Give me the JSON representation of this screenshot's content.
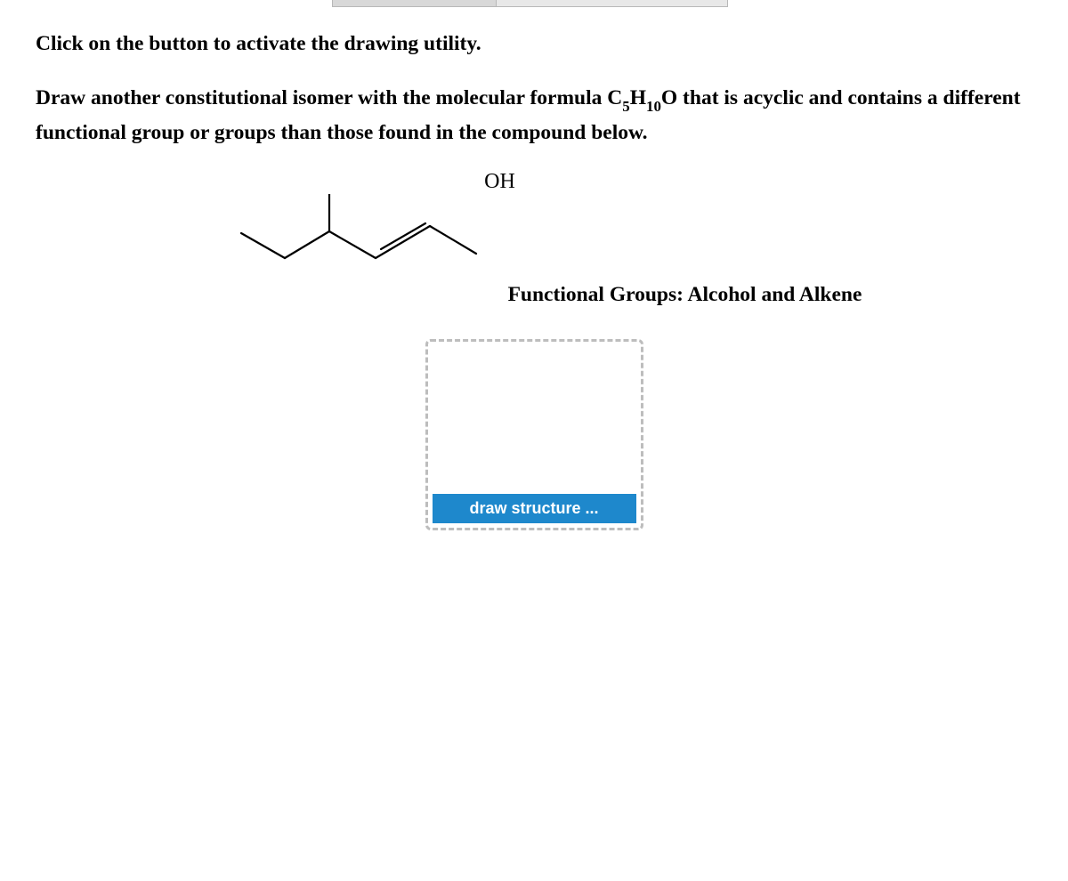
{
  "instruction": "Click on the button to activate the drawing utility.",
  "question_part1": "Draw another constitutional isomer with the molecular formula C",
  "question_sub1": "5",
  "question_part2": "H",
  "question_sub2": "10",
  "question_part3": "O that is acyclic and contains a different functional group or groups than those found in the compound below.",
  "molecule": {
    "hydroxyl_label": "OH"
  },
  "functional_groups_label": "Functional Groups: Alcohol and Alkene",
  "draw_button_label": "draw structure ..."
}
